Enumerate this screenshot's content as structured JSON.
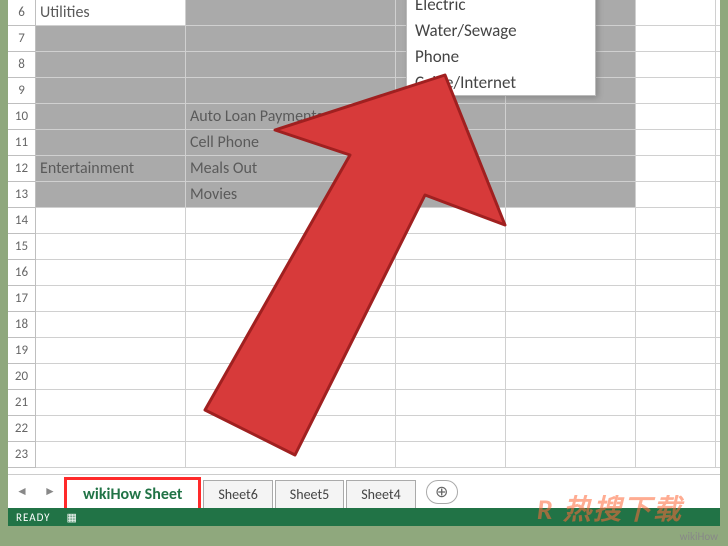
{
  "rows": [
    "6",
    "7",
    "8",
    "9",
    "10",
    "11",
    "12",
    "13",
    "14",
    "15",
    "16",
    "17",
    "18",
    "19",
    "20",
    "21",
    "22",
    "23"
  ],
  "cellA": {
    "6": "Utilities",
    "12": "Entertainment"
  },
  "cellB": {
    "10": "Auto Loan Payments",
    "11": "Cell Phone",
    "12": "Meals Out",
    "13": "Movies"
  },
  "tooltip": [
    "Electric",
    "Water/Sewage",
    "Phone",
    "Cable/Internet"
  ],
  "tabs": {
    "active": "wikiHow Sheet",
    "others": [
      "Sheet6",
      "Sheet5",
      "Sheet4"
    ]
  },
  "status": "READY",
  "watermark_main": "R 热搜下载",
  "watermark_sub": "wikiHow"
}
